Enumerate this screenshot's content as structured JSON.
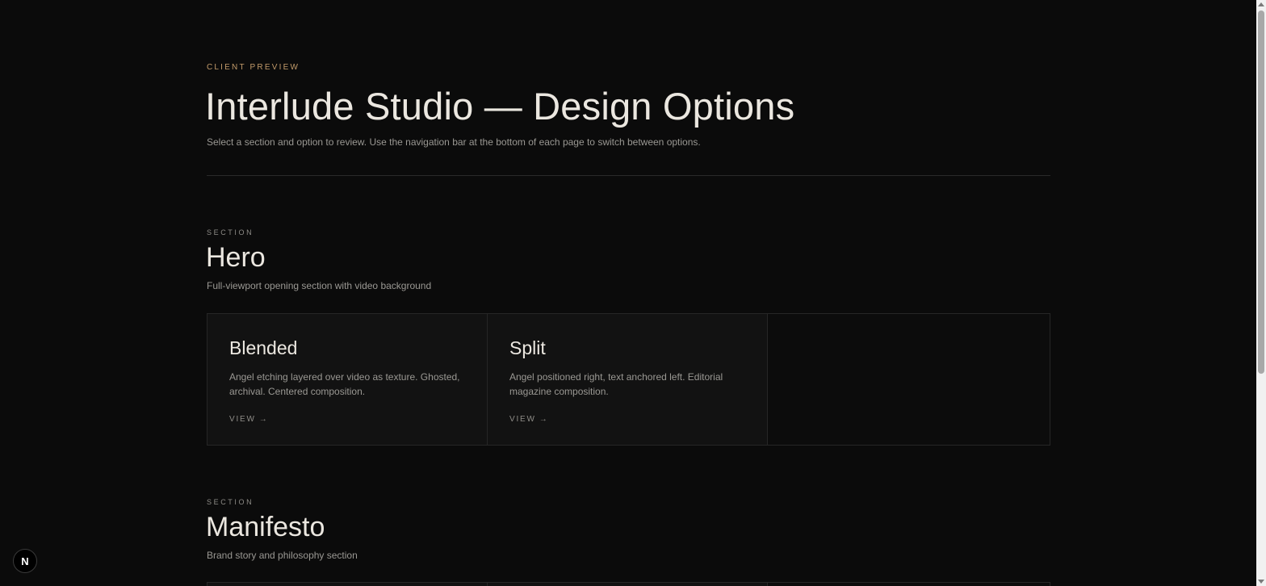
{
  "header": {
    "eyebrow": "CLIENT PREVIEW",
    "title": "Interlude Studio — Design Options",
    "subtitle": "Select a section and option to review. Use the navigation bar at the bottom of each page to switch between options."
  },
  "sections": [
    {
      "label": "SECTION",
      "title": "Hero",
      "description": "Full-viewport opening section with video background",
      "options": [
        {
          "title": "Blended",
          "description": "Angel etching layered over video as texture. Ghosted, archival. Centered composition.",
          "link": "VIEW",
          "arrow": "→"
        },
        {
          "title": "Split",
          "description": "Angel positioned right, text anchored left. Editorial magazine composition.",
          "link": "VIEW",
          "arrow": "→"
        }
      ]
    },
    {
      "label": "SECTION",
      "title": "Manifesto",
      "description": "Brand story and philosophy section"
    }
  ],
  "dev_badge": {
    "letter": "N"
  },
  "colors": {
    "background": "#0b0b0b",
    "accent": "#c29b6a",
    "card": "#121212",
    "text": "#ebe7e0",
    "muted": "#9a9893"
  }
}
